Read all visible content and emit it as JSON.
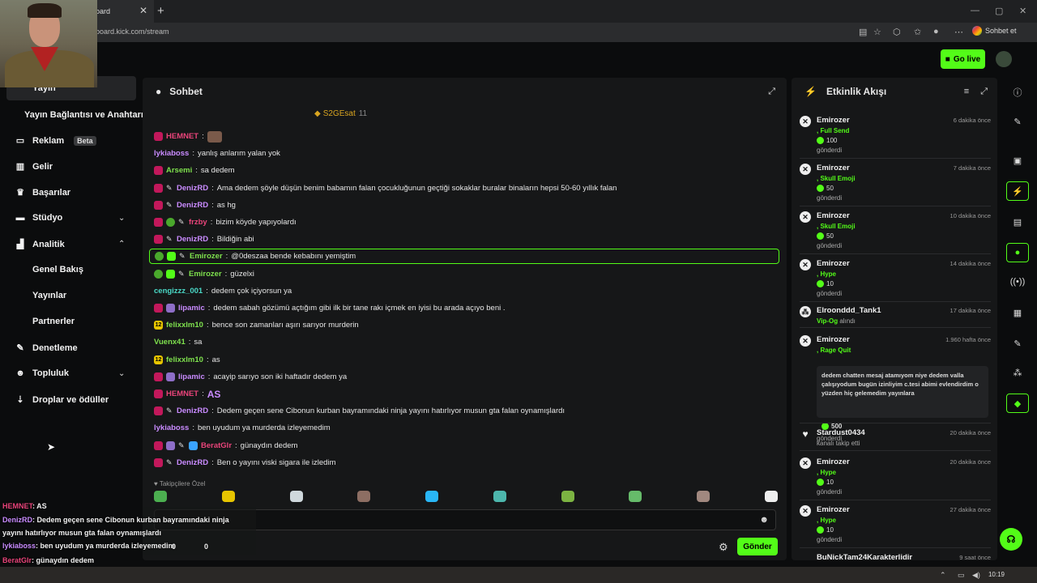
{
  "browser": {
    "tab_title": "oard",
    "close": "✕",
    "new_tab": "+",
    "url": "board.kick.com/stream",
    "sohbet_et": "Sohbet et",
    "win_min": "—",
    "win_max": "▢",
    "win_close": "✕"
  },
  "topbar": {
    "go_live": "Go live"
  },
  "sidebar": {
    "active": "Yayın",
    "stream_connection": "Yayın Bağlantısı ve Anahtarı",
    "items": [
      {
        "label": "Reklam",
        "icon": "tv-icon",
        "badge": "Beta"
      },
      {
        "label": "Gelir",
        "icon": "revenue-icon"
      },
      {
        "label": "Başarılar",
        "icon": "trophy-icon"
      },
      {
        "label": "Stüdyo",
        "icon": "studio-icon"
      },
      {
        "label": "Analitik",
        "icon": "analytics-icon"
      },
      {
        "label": "Denetleme",
        "icon": "wrench-icon"
      },
      {
        "label": "Topluluk",
        "icon": "community-icon"
      },
      {
        "label": "Droplar ve ödüller",
        "icon": "drops-icon"
      }
    ],
    "sub_items": [
      "Genel Bakış",
      "Yayınlar",
      "Partnerler"
    ]
  },
  "chat": {
    "title": "Sohbet",
    "pinned_user": "S2GEsat",
    "pinned_count": "11",
    "followers_only": "Takipçilere Özel",
    "send": "Gönder",
    "messages": [
      {
        "user": "HEMNET",
        "text": "",
        "color": "c-pink",
        "badges": [
          "sub"
        ],
        "emote": "img"
      },
      {
        "user": "lykiaboss",
        "text": "yanlış anlarım yalan yok",
        "color": "c-purp",
        "badges": []
      },
      {
        "user": "Arsemi",
        "text": "sa dedem",
        "color": "c-green",
        "badges": [
          "sub"
        ]
      },
      {
        "user": "DenizRD",
        "text": "Ama dedem şöyle düşün benim babamın falan çocukluğunun geçtiği sokaklar buralar binaların hepsi 50-60 yıllık falan",
        "color": "c-purp",
        "badges": [
          "sub",
          "pen"
        ]
      },
      {
        "user": "DenizRD",
        "text": "as hg",
        "color": "c-purp",
        "badges": [
          "sub",
          "pen"
        ]
      },
      {
        "user": "frzby",
        "text": "bizim köyde yapıyolardı",
        "color": "c-pink",
        "badges": [
          "sub",
          "og",
          "pen"
        ]
      },
      {
        "user": "DenizRD",
        "text": "Bildiğin abi",
        "color": "c-purp",
        "badges": [
          "sub",
          "pen"
        ]
      },
      {
        "user": "Emirozer",
        "text": "@0deszaa bende kebabını yemiştim",
        "color": "c-green",
        "badges": [
          "og",
          "mod",
          "pen"
        ],
        "highlight": true
      },
      {
        "user": "Emirozer",
        "text": "güzelxi",
        "color": "c-green",
        "badges": [
          "og",
          "mod",
          "pen"
        ]
      },
      {
        "user": "cengizzz_001",
        "text": "dedem çok içiyorsun ya",
        "color": "c-teal",
        "badges": []
      },
      {
        "user": "lipamic",
        "text": "dedem sabah gözümü açtığım gibi ilk bir tane rakı içmek en iyisi bu arada açıyo beni .",
        "color": "c-purp",
        "badges": [
          "sub",
          "vip"
        ]
      },
      {
        "user": "felixxlm10",
        "text": "bence son zamanları aşırı sarıyor murderin",
        "color": "c-green",
        "badges": [
          "gift"
        ]
      },
      {
        "user": "Vuenx41",
        "text": "sa",
        "color": "c-green",
        "badges": []
      },
      {
        "user": "felixxlm10",
        "text": "as",
        "color": "c-green",
        "badges": [
          "gift"
        ]
      },
      {
        "user": "lipamic",
        "text": "acayip sarıyo son iki haftadır dedem ya",
        "color": "c-purp",
        "badges": [
          "sub",
          "vip"
        ]
      },
      {
        "user": "HEMNET",
        "text": "",
        "color": "c-pink",
        "badges": [
          "sub"
        ],
        "emote": "AS"
      },
      {
        "user": "DenizRD",
        "text": "Dedem geçen sene Cibonun kurban bayramındaki ninja yayını hatırlıyor musun gta falan oynamışlardı",
        "color": "c-purp",
        "badges": [
          "sub",
          "pen"
        ]
      },
      {
        "user": "lykiaboss",
        "text": "ben uyudum ya murderda izleyemedim",
        "color": "c-purp",
        "badges": []
      },
      {
        "user": "BeratGlr",
        "text": "günaydın dedem",
        "color": "c-pink",
        "badges": [
          "sub",
          "vip",
          "pen",
          "blue"
        ]
      },
      {
        "user": "DenizRD",
        "text": "Ben o yayını viski sigara ile izledim",
        "color": "c-purp",
        "badges": [
          "sub",
          "pen"
        ]
      }
    ]
  },
  "activity": {
    "title": "Etkinlik Akışı",
    "events": [
      {
        "name": "Emirozer",
        "time": "6 dakika önce",
        "item": ", Full Send",
        "amount": "100",
        "sent": "gönderdi",
        "icon": "kick"
      },
      {
        "name": "Emirozer",
        "time": "7 dakika önce",
        "item": ", Skull Emoji",
        "amount": "50",
        "sent": "gönderdi",
        "icon": "kick"
      },
      {
        "name": "Emirozer",
        "time": "10 dakika önce",
        "item": ", Skull Emoji",
        "amount": "50",
        "sent": "gönderdi",
        "icon": "kick"
      },
      {
        "name": "Emirozer",
        "time": "14 dakika önce",
        "item": ", Hype",
        "amount": "10",
        "sent": "gönderdi",
        "icon": "kick"
      }
    ],
    "vip": {
      "name": "Elroonddd_Tank1",
      "time": "17 dakika önce",
      "item": "Vip-Og",
      "action": "alındı"
    },
    "rage": {
      "name": "Emirozer",
      "time": "1.960 hafta önce",
      "item": ", Rage Quit",
      "message": "dedem chatten mesaj atamıyom niye dedem valla çalışıyodum bugün izinliyim c.tesi abimi evlendirdim o yüzden hiç gelemedim yayınlara",
      "amount": "500",
      "sent": "gönderdi"
    },
    "follow": {
      "name": "Stardust0434",
      "time": "20 dakika önce",
      "text": "kanalı takip etti"
    },
    "events2": [
      {
        "name": "Emirozer",
        "time": "20 dakika önce",
        "item": ", Hype",
        "amount": "10",
        "sent": "gönderdi"
      },
      {
        "name": "Emirozer",
        "time": "27 dakika önce",
        "item": ", Hype",
        "amount": "10",
        "sent": "gönderdi"
      }
    ],
    "last": {
      "name": "BuNickTam24Karakterlidir",
      "time": "9 saat önce"
    }
  },
  "overlay": {
    "lines": [
      {
        "user": "HEMNET",
        "text": ": AS"
      },
      {
        "user": "DenizRD",
        "text": ": Dedem geçen sene Cibonun kurban bayramındaki ninja"
      },
      {
        "user": "",
        "text": "yayını hatırlıyor musun gta falan oynamışlardı"
      },
      {
        "user": "lykiaboss",
        "text": ": ben uyudum ya murderda izleyemedim"
      },
      {
        "user": "BeratGlr",
        "text": ": günaydın dedem"
      },
      {
        "user": "DenizRD",
        "text": ": Ben o yayını viski sigara ile izledim"
      }
    ],
    "counter_a": "0",
    "counter_b": "0"
  },
  "taskbar": {
    "time": "10:19"
  }
}
